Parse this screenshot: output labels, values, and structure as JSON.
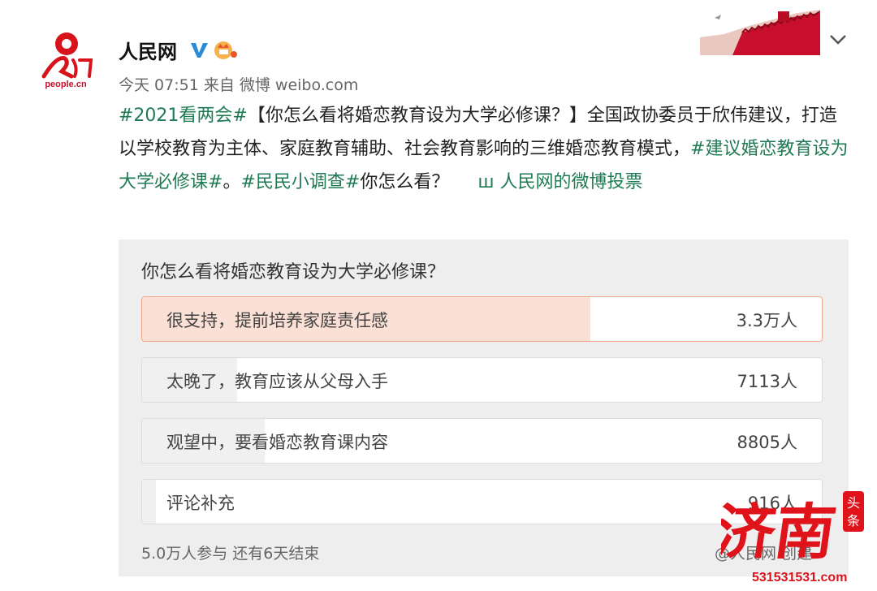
{
  "account": {
    "name": "人民网",
    "logo_text": "people.cn",
    "meta": "今天 07:51 来自 微博 weibo.com"
  },
  "post": {
    "topic1": "#2021看两会#",
    "text1": "【你怎么看将婚恋教育设为大学必修课？】全国政协委员于欣伟建议，打造以学校教育为主体、家庭教育辅助、社会教育影响的三维婚恋教育模式，",
    "topic2": "#建议婚恋教育设为大学必修课#",
    "text2": "。",
    "topic3": "#民民小调查#",
    "text3": "你怎么看？",
    "link_icon": "ш",
    "link_text": "人民网的微博投票"
  },
  "vote": {
    "question": "你怎么看将婚恋教育设为大学必修课？",
    "options": [
      {
        "label": "很支持，提前培养家庭责任感",
        "count": "3.3万人",
        "fraction": 0.66,
        "selected": true
      },
      {
        "label": "太晚了，教育应该从父母入手",
        "count": "7113人",
        "fraction": 0.14,
        "selected": false
      },
      {
        "label": "观望中，要看婚恋教育课内容",
        "count": "8805人",
        "fraction": 0.18,
        "selected": false
      },
      {
        "label": "评论补充",
        "count": "916人",
        "fraction": 0.02,
        "selected": false
      }
    ],
    "footer_left": "5.0万人参与 还有6天结束",
    "footer_right": "@人民网 创建"
  },
  "watermark": {
    "text": "济南",
    "seal": "头条",
    "url": "531531531.com"
  },
  "colors": {
    "topic": "#1f7a55",
    "selected_fill": "#fbe0d6",
    "selected_border": "#f2a58a",
    "brand_red": "#c8102e"
  }
}
